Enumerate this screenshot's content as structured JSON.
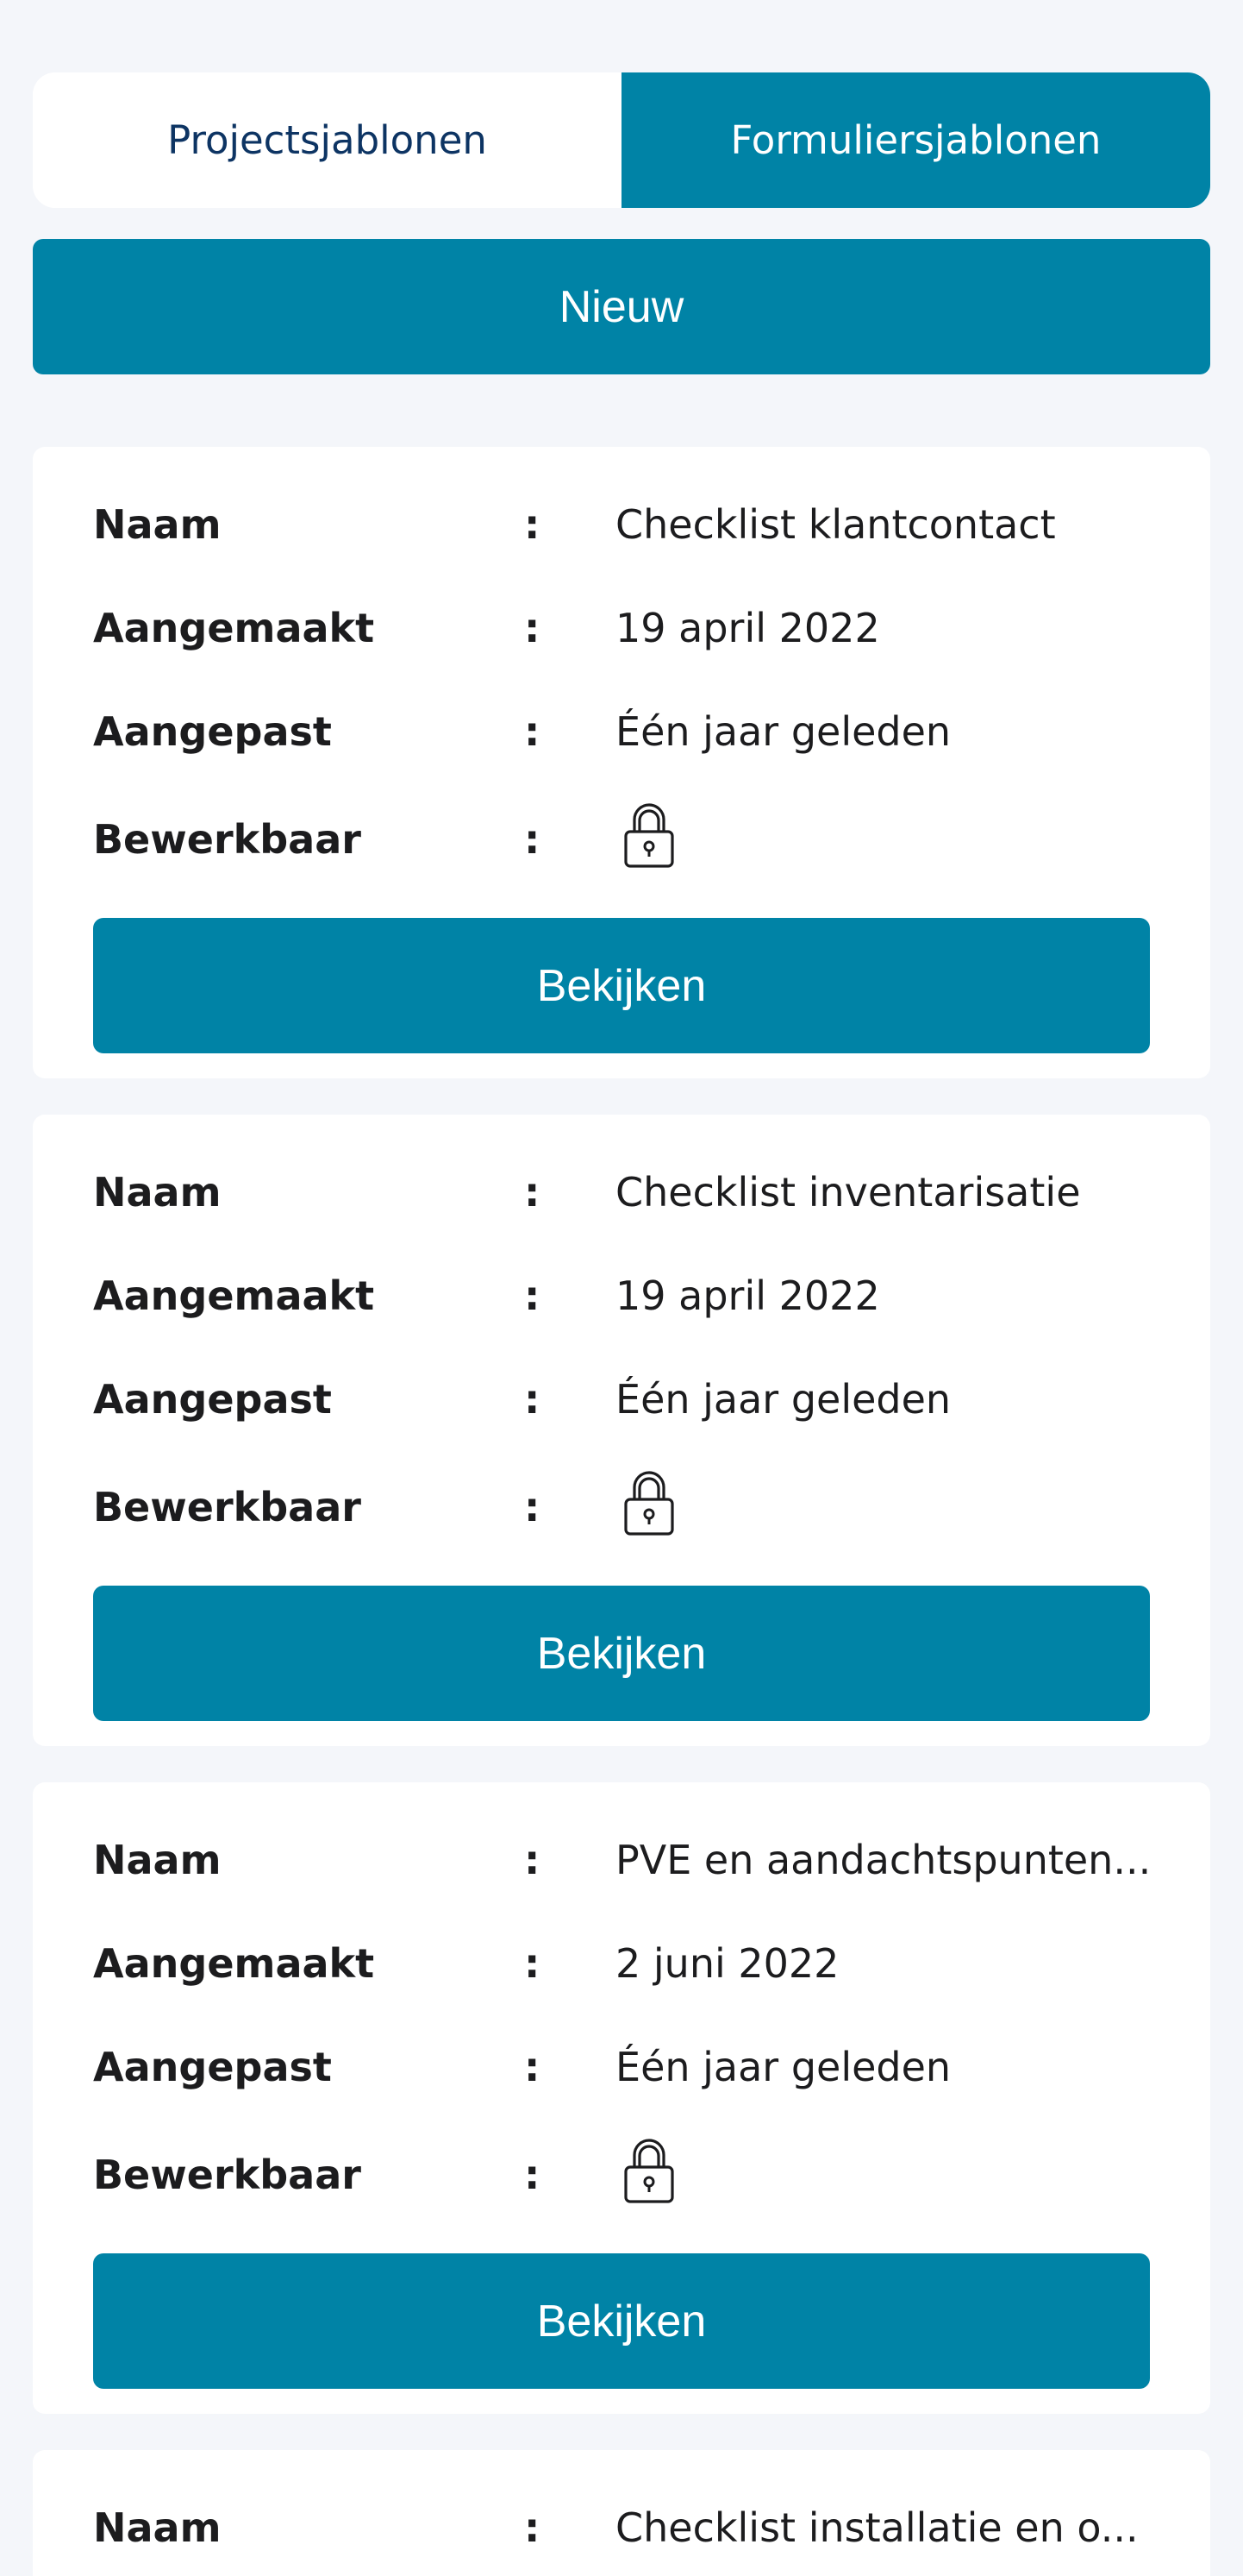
{
  "tabs": {
    "projects_label": "Projectsjablonen",
    "forms_label": "Formuliersjablonen",
    "active": "forms"
  },
  "actions": {
    "new_label": "Nieuw"
  },
  "labels": {
    "name": "Naam",
    "created": "Aangemaakt",
    "modified": "Aangepast",
    "editable": "Bewerkbaar",
    "separator": ":",
    "view_button": "Bekijken"
  },
  "templates": [
    {
      "name": "Checklist klantcontact",
      "created": "19 april 2022",
      "modified": "Één jaar geleden",
      "editable_icon": "lock-icon"
    },
    {
      "name": "Checklist inventarisatie",
      "created": "19 april 2022",
      "modified": "Één jaar geleden",
      "editable_icon": "lock-icon"
    },
    {
      "name": "PVE en aandachtspunten...",
      "created": "2 juni 2022",
      "modified": "Één jaar geleden",
      "editable_icon": "lock-icon"
    },
    {
      "name": "Checklist installatie en o..."
    }
  ],
  "colors": {
    "accent": "#0083a6",
    "background": "#f4f6fa",
    "tab_inactive_text": "#0d3463"
  }
}
